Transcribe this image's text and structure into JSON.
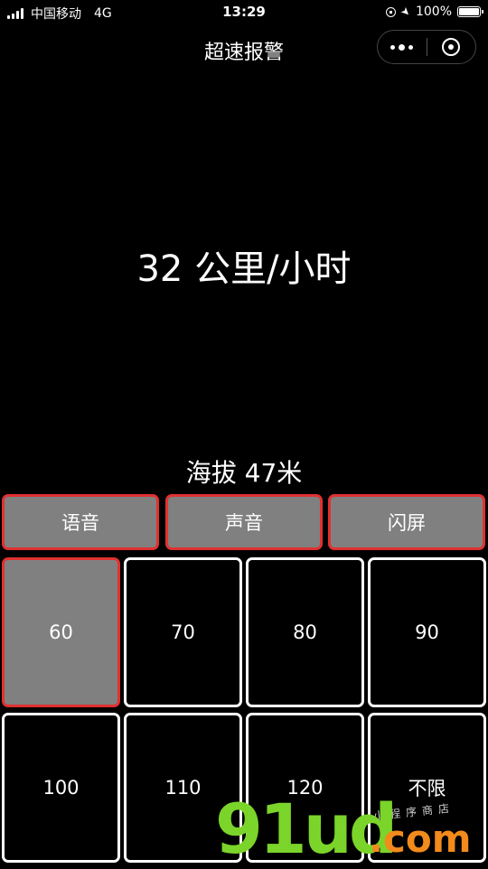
{
  "status_bar": {
    "carrier": "中国移动",
    "network": "4G",
    "time": "13:29",
    "battery": "100%",
    "battery_level": 1.0
  },
  "nav": {
    "title": "超速报警"
  },
  "main": {
    "speed_text": "32 公里/小时",
    "altitude_text": "海拔 47米"
  },
  "modes": [
    {
      "label": "语音"
    },
    {
      "label": "声音"
    },
    {
      "label": "闪屏"
    }
  ],
  "limits": [
    {
      "label": "60",
      "selected": true
    },
    {
      "label": "70",
      "selected": false
    },
    {
      "label": "80",
      "selected": false
    },
    {
      "label": "90",
      "selected": false
    },
    {
      "label": "100",
      "selected": false
    },
    {
      "label": "110",
      "selected": false
    },
    {
      "label": "120",
      "selected": false
    },
    {
      "label": "不限",
      "selected": false
    }
  ],
  "watermark": {
    "main": "91ud",
    "suffix": ".com",
    "small": "小程序商店"
  },
  "colors": {
    "background": "#000000",
    "accent_red": "#e03131",
    "button_gray": "#808080",
    "watermark_green": "#7bd42a",
    "watermark_orange": "#f28a1c"
  }
}
